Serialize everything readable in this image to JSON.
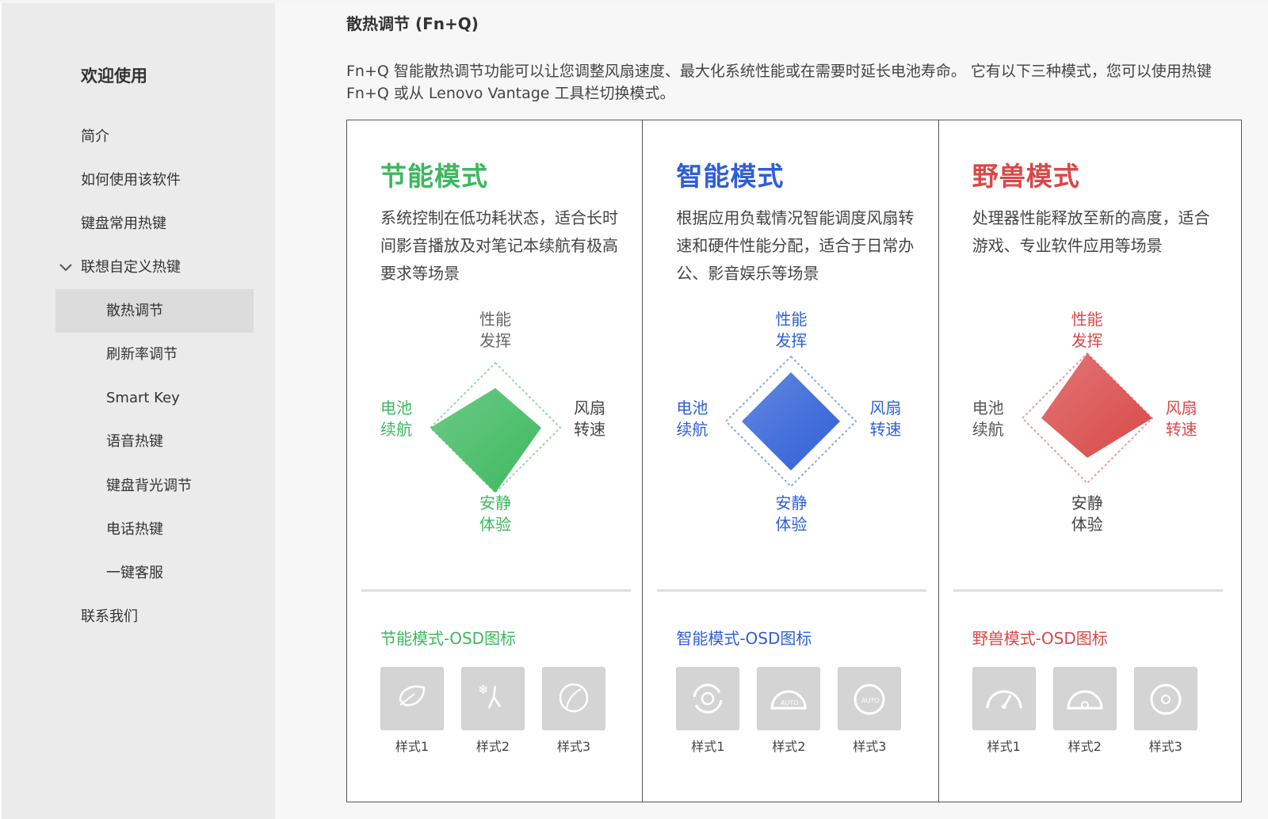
{
  "sidebar": {
    "welcome": "欢迎使用",
    "items": [
      {
        "label": "简介"
      },
      {
        "label": "如何使用该软件"
      },
      {
        "label": "键盘常用热键"
      },
      {
        "label": "联想自定义热键"
      },
      {
        "label": "散热调节"
      },
      {
        "label": "刷新率调节"
      },
      {
        "label": "Smart Key"
      },
      {
        "label": "语音热键"
      },
      {
        "label": "键盘背光调节"
      },
      {
        "label": "电话热键"
      },
      {
        "label": "一键客服"
      },
      {
        "label": "联系我们"
      }
    ]
  },
  "main": {
    "title": "散热调节 (Fn+Q)",
    "intro": "Fn+Q 智能散热调节功能可以让您调整风扇速度、最大化系统性能或在需要时延长电池寿命。 它有以下三种模式，您可以使用热键 Fn+Q 或从 Lenovo Vantage 工具栏切换模式。",
    "cards": [
      {
        "title": "节能模式",
        "color": "#3cb85e",
        "desc": "系统控制在低功耗状态，适合长时间影音播放及对笔记本续航有极高要求等场景",
        "labels": {
          "top": "性能\n发挥",
          "left": "电池\n续航",
          "right": "风扇\n转速",
          "bottom": "安静\n体验"
        },
        "osd_title": "节能模式-OSD图标",
        "osd": [
          "样式1",
          "样式2",
          "样式3"
        ],
        "icons": [
          "leaf-icon",
          "snowflake-figure-icon",
          "moon-leaf-icon"
        ]
      },
      {
        "title": "智能模式",
        "color": "#2f5fd6",
        "desc": "根据应用负载情况智能调度风扇转速和硬件性能分配，适合于日常办公、影音娱乐等场景",
        "labels": {
          "top": "性能\n发挥",
          "left": "电池\n续航",
          "right": "风扇\n转速",
          "bottom": "安静\n体验"
        },
        "osd_title": "智能模式-OSD图标",
        "osd": [
          "样式1",
          "样式2",
          "样式3"
        ],
        "icons": [
          "fan-refresh-icon",
          "auto-gauge-icon",
          "auto-dial-icon"
        ]
      },
      {
        "title": "野兽模式",
        "color": "#d94848",
        "desc": "处理器性能释放至新的高度，适合游戏、专业软件应用等场景",
        "labels": {
          "top": "性能\n发挥",
          "left": "电池\n续航",
          "right": "风扇\n转速",
          "bottom": "安静\n体验"
        },
        "osd_title": "野兽模式-OSD图标",
        "osd": [
          "样式1",
          "样式2",
          "样式3"
        ],
        "icons": [
          "speedometer-icon",
          "gauge-icon",
          "dial-icon"
        ]
      }
    ]
  }
}
